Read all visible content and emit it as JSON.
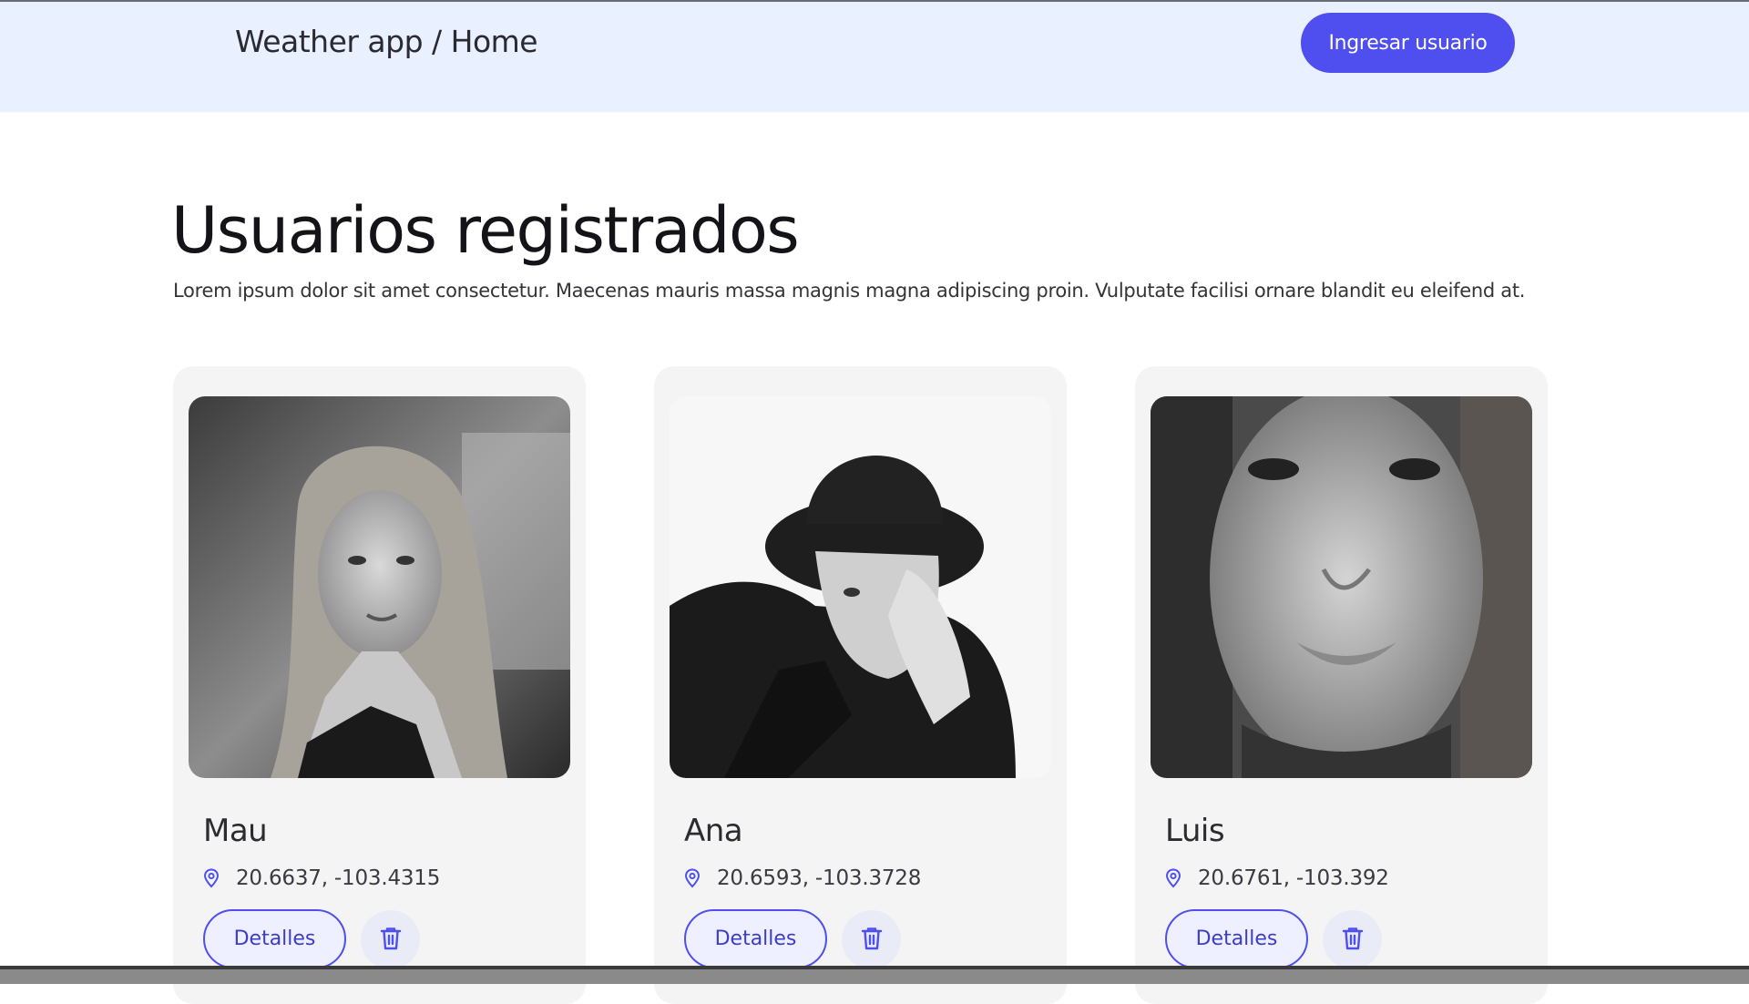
{
  "header": {
    "breadcrumb": "Weather app / Home",
    "cta_label": "Ingresar usuario"
  },
  "main": {
    "title": "Usuarios registrados",
    "description": "Lorem ipsum dolor sit amet consectetur. Maecenas mauris massa magnis magna adipiscing proin. Vulputate facilisi ornare blandit eu eleifend at."
  },
  "users": [
    {
      "name": "Mau",
      "coords": "20.6637, -103.4315",
      "details_label": "Detalles"
    },
    {
      "name": "Ana",
      "coords": "20.6593, -103.3728",
      "details_label": "Detalles"
    },
    {
      "name": "Luis",
      "coords": "20.6761, -103.392",
      "details_label": "Detalles"
    }
  ],
  "icons": {
    "location": "map-pin-icon",
    "delete": "trash-icon"
  },
  "colors": {
    "accent": "#4f4ff0",
    "navbar_bg": "#e9f0ff",
    "card_bg": "#f4f4f4"
  }
}
